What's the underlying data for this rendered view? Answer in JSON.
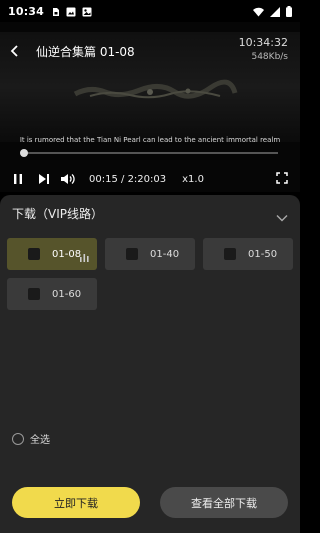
{
  "status_bar": {
    "time": "10:34",
    "left_icons": [
      "sim-icon",
      "photo-icon",
      "image-icon"
    ],
    "right_icons": [
      "wifi-icon",
      "signal-icon",
      "battery-icon"
    ]
  },
  "player": {
    "title": "仙逆合集篇 01-08",
    "clock": "10:34:32",
    "net_speed": "548Kb/s",
    "subtitle": "It is rumored that the Tian Ni Pearl can lead to the ancient immortal realm",
    "progress": 0.0019,
    "current_time": "00:15",
    "separator": " / ",
    "total_time": "2:20:03",
    "playback_rate": "x1.0",
    "icons": {
      "back": "back-arrow-icon",
      "pause": "pause-icon",
      "next": "next-episode-icon",
      "volume": "volume-icon",
      "fullscreen": "fullscreen-icon"
    }
  },
  "download": {
    "header": "下载（VIP线路）",
    "episodes": [
      {
        "label": "01-08",
        "active": true
      },
      {
        "label": "01-40",
        "active": false
      },
      {
        "label": "01-50",
        "active": false
      },
      {
        "label": "01-60",
        "active": false
      }
    ],
    "select_all_label": "全选",
    "primary_button": "立即下载",
    "secondary_button": "查看全部下载"
  },
  "colors": {
    "accent_yellow": "#f1da4c",
    "panel_bg": "#262626",
    "active_episode_bg": "#56542b"
  }
}
